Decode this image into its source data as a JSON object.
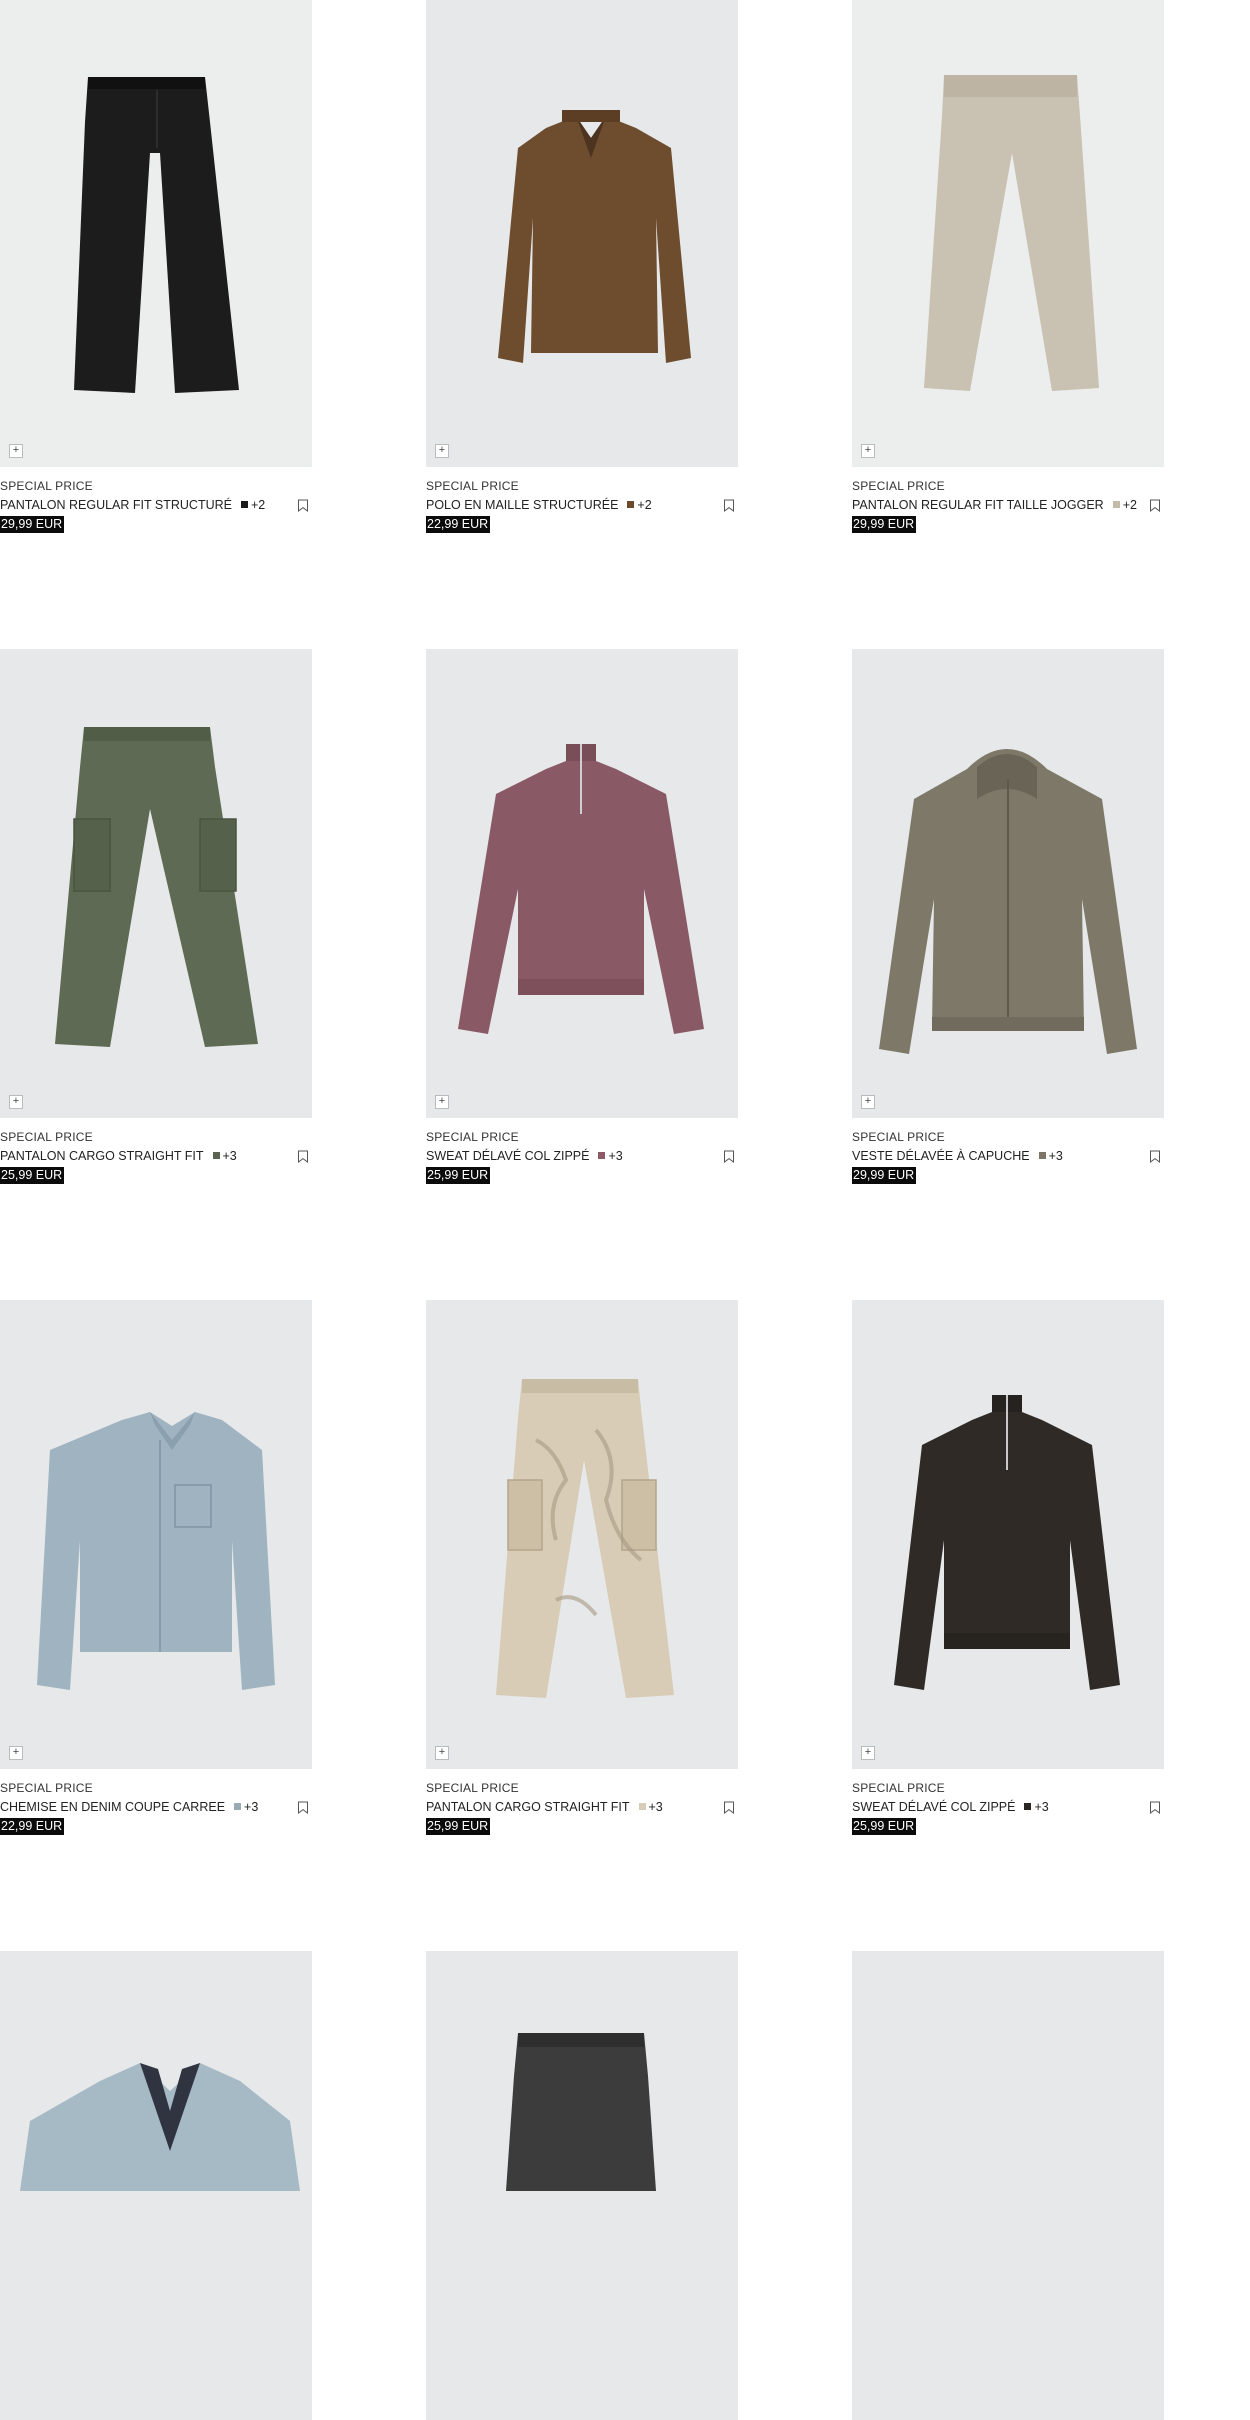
{
  "products": [
    {
      "badge": "SPECIAL PRICE",
      "name": "PANTALON REGULAR FIT STRUCTURÉ",
      "swatch": "#1a1a1a",
      "more": "+2",
      "price": "29,99 EUR",
      "image": "black-trousers"
    },
    {
      "badge": "SPECIAL PRICE",
      "name": "POLO EN MAILLE STRUCTURÉE",
      "swatch": "#6b4a2c",
      "more": "+2",
      "price": "22,99 EUR",
      "image": "brown-knit-polo"
    },
    {
      "badge": "SPECIAL PRICE",
      "name": "PANTALON REGULAR FIT TAILLE JOGGER",
      "swatch": "#c4baa8",
      "more": "+2",
      "price": "29,99 EUR",
      "image": "beige-jogger-trousers"
    },
    {
      "badge": "SPECIAL PRICE",
      "name": "PANTALON CARGO STRAIGHT FIT",
      "swatch": "#5a6450",
      "more": "+3",
      "price": "25,99 EUR",
      "image": "khaki-cargo-trousers"
    },
    {
      "badge": "SPECIAL PRICE",
      "name": "SWEAT DÉLAVÉ COL ZIPPÉ",
      "swatch": "#8c5a66",
      "more": "+3",
      "price": "25,99 EUR",
      "image": "mauve-zip-sweatshirt"
    },
    {
      "badge": "SPECIAL PRICE",
      "name": "VESTE DÉLAVÉE À CAPUCHE",
      "swatch": "#7d7667",
      "more": "+3",
      "price": "29,99 EUR",
      "image": "grey-hooded-jacket"
    },
    {
      "badge": "SPECIAL PRICE",
      "name": "CHEMISE EN DENIM COUPE CARREE",
      "swatch": "#9aaab3",
      "more": "+3",
      "price": "22,99 EUR",
      "image": "light-denim-shirt"
    },
    {
      "badge": "SPECIAL PRICE",
      "name": "PANTALON CARGO STRAIGHT FIT",
      "swatch": "#d6ccb8",
      "more": "+3",
      "price": "25,99 EUR",
      "image": "camo-cargo-trousers"
    },
    {
      "badge": "SPECIAL PRICE",
      "name": "SWEAT DÉLAVÉ COL ZIPPÉ",
      "swatch": "#2a2623",
      "more": "+3",
      "price": "25,99 EUR",
      "image": "dark-zip-sweatshirt"
    },
    {
      "image": "light-blue-blazer"
    },
    {
      "image": "grey-tailored-trousers"
    },
    {
      "image": "product-photo"
    }
  ],
  "icons": {
    "add": "plus-icon",
    "save": "bookmark-icon"
  },
  "add_symbol": "+"
}
